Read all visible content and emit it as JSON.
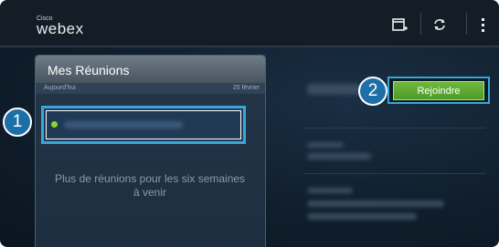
{
  "header": {
    "brand_small": "Cisco",
    "brand_name": "webex",
    "icons": [
      "calendar-add-icon",
      "refresh-icon",
      "overflow-menu-icon"
    ]
  },
  "meetings_panel": {
    "title": "Mes Réunions",
    "day_label": "Aujourd'hui",
    "date_label": "25 février",
    "more_meetings_text_line1": "Plus de réunions pour les six semaines",
    "more_meetings_text_line2": "à venir"
  },
  "callouts": {
    "one": "1",
    "two": "2"
  },
  "details": {
    "join_button_label": "Rejoindre"
  },
  "colors": {
    "accent_blue": "#3aa6d8",
    "callout_blue": "#1d6fa8",
    "join_green": "#5aa832",
    "status_dot_green": "#8ed335"
  }
}
